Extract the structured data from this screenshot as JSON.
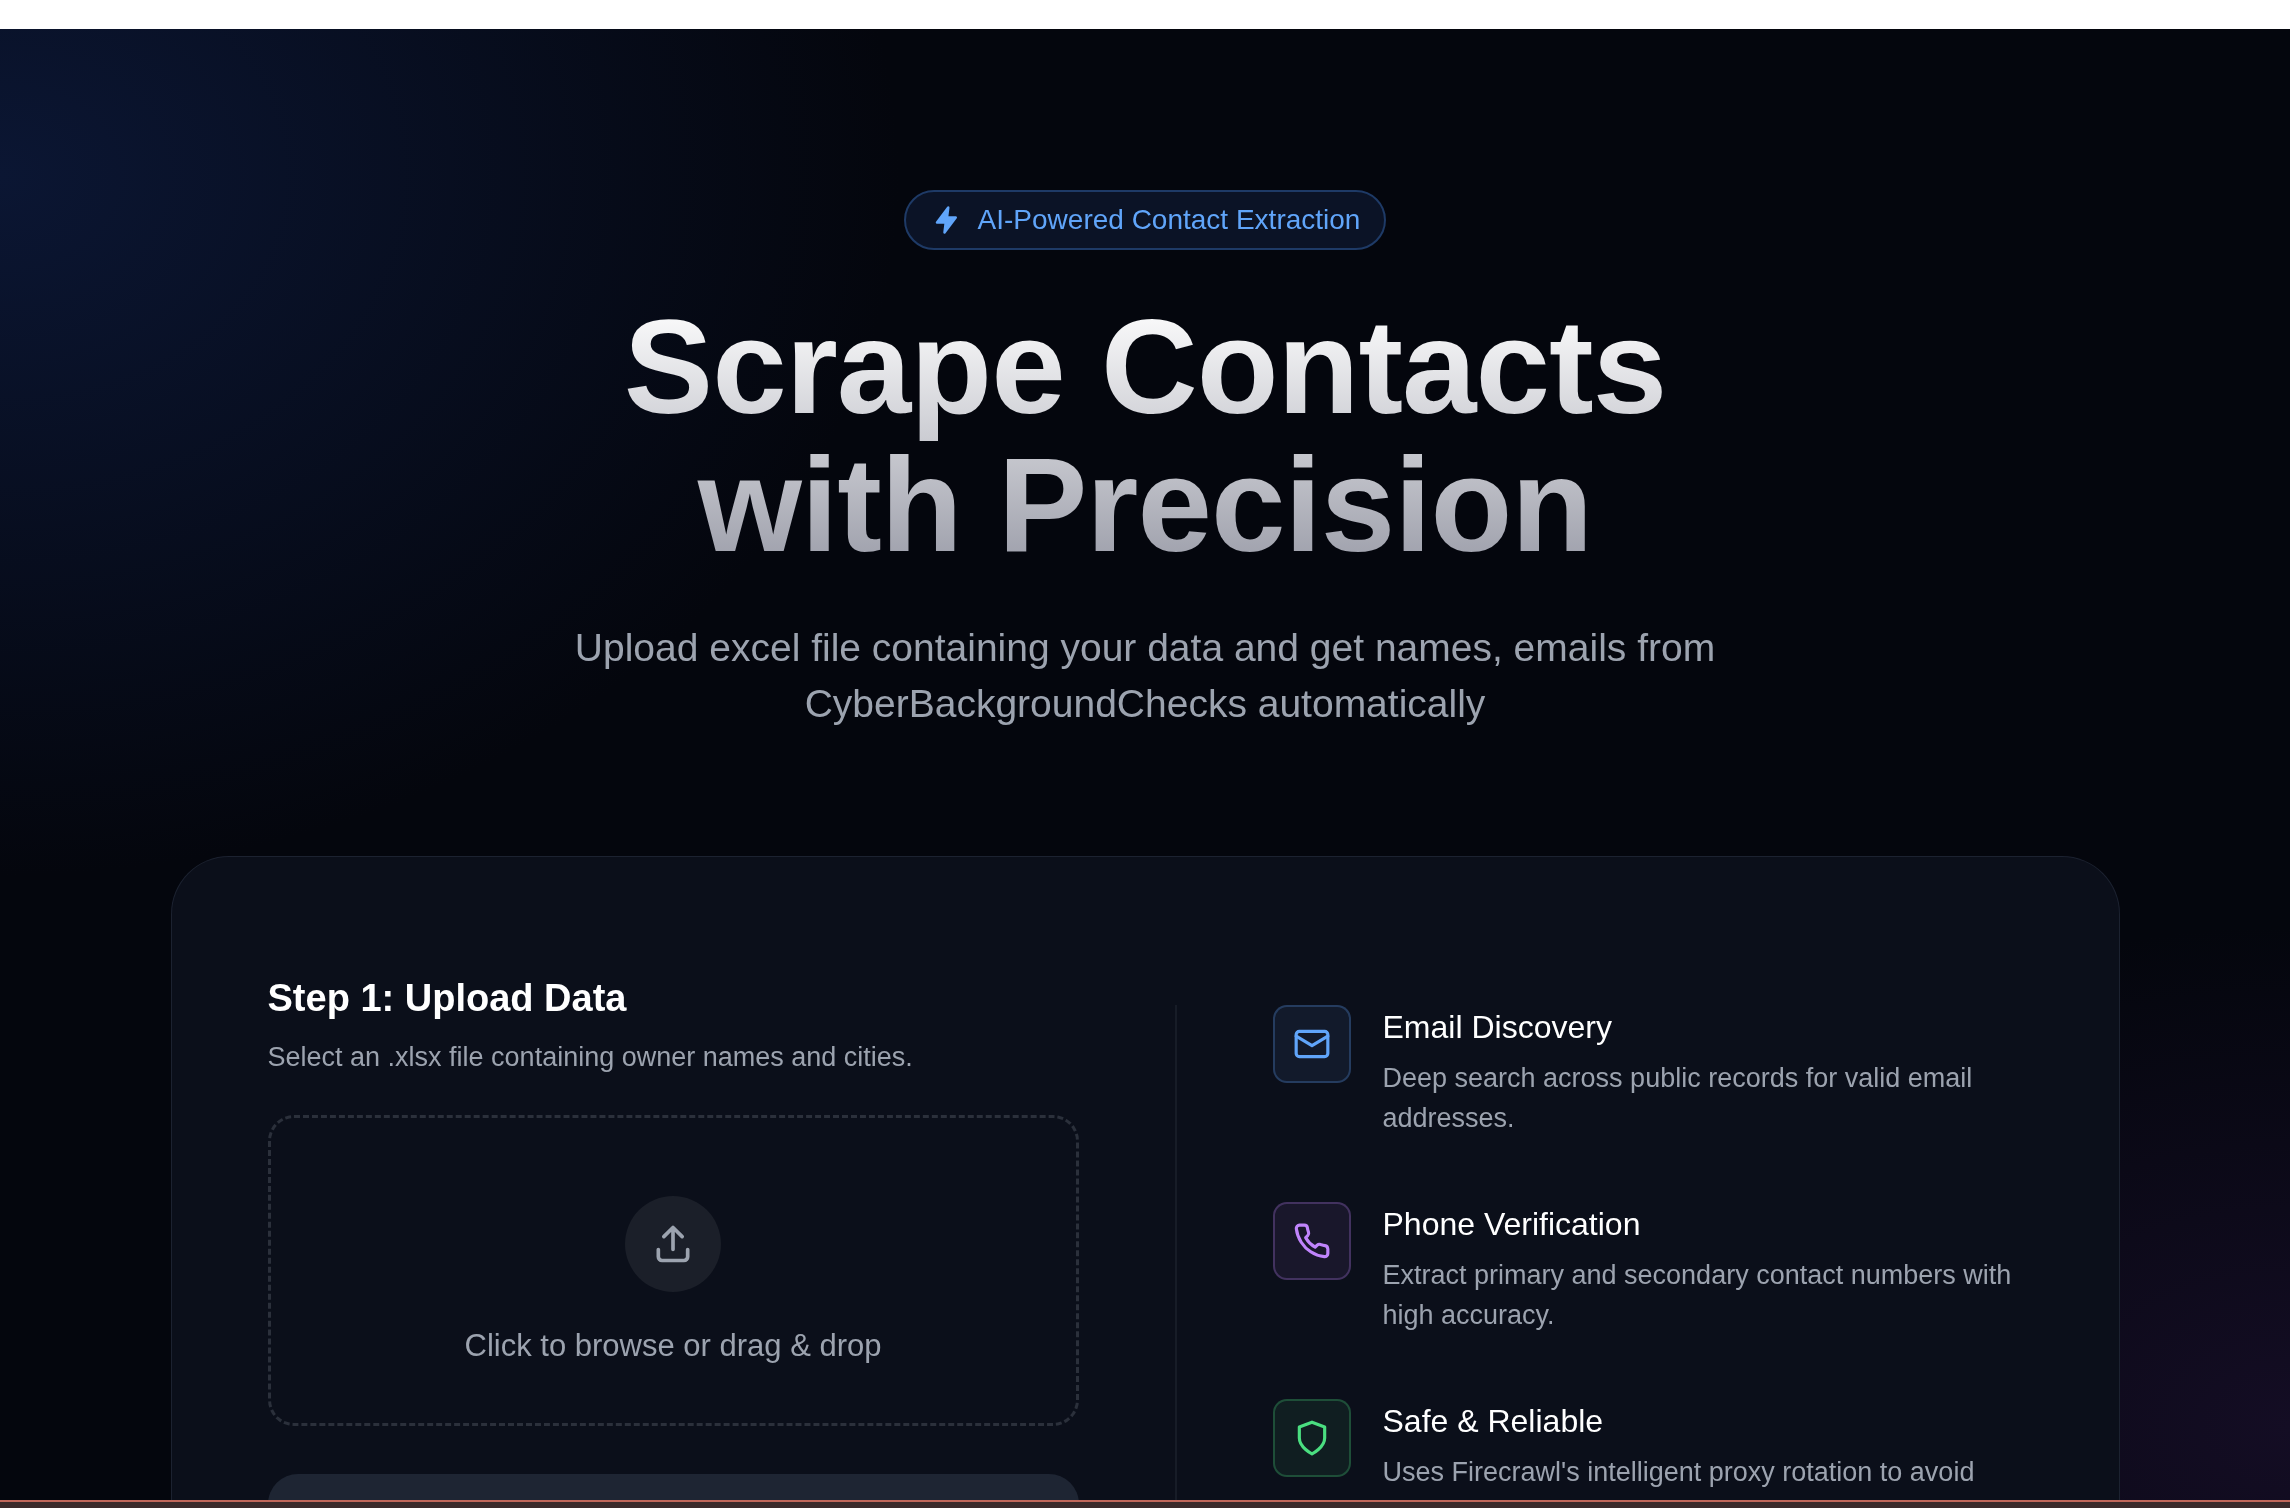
{
  "hero": {
    "badge": "AI-Powered Contact Extraction",
    "title_lines": [
      "Scrape Contacts",
      "with Precision"
    ],
    "subtitle": "Upload excel file containing your data and get names, emails from CyberBackgroundChecks automatically"
  },
  "upload": {
    "title": "Step 1: Upload Data",
    "description": "Select an .xlsx file containing owner names and cities.",
    "dropzone_text": "Click to browse or drag & drop"
  },
  "features": [
    {
      "kind": "email",
      "color": "#60a5fa",
      "title": "Email Discovery",
      "description": "Deep search across public records for valid email addresses."
    },
    {
      "kind": "phone",
      "color": "#c084fc",
      "title": "Phone Verification",
      "description": "Extract primary and secondary contact numbers with high accuracy."
    },
    {
      "kind": "shield",
      "color": "#4ade80",
      "title": "Safe & Reliable",
      "description": "Uses Firecrawl's intelligent proxy rotation to avoid"
    }
  ]
}
